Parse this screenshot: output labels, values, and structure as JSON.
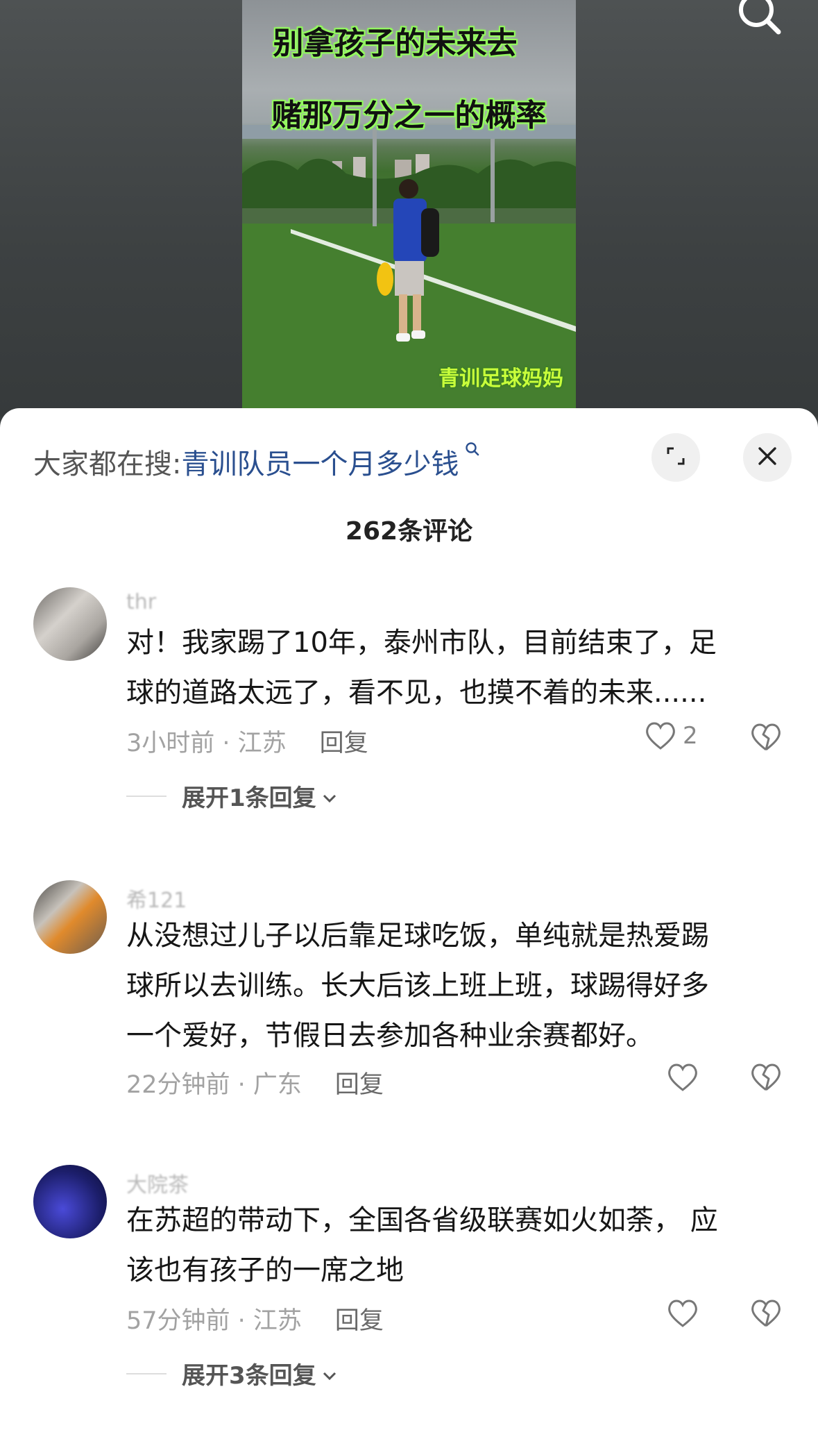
{
  "video": {
    "title_line1": "别拿孩子的未来去",
    "title_line2": "赌那万分之一的概率",
    "watermark": "青训足球妈妈"
  },
  "search_hint": {
    "prefix": "大家都在搜:",
    "query": "青训队员一个月多少钱"
  },
  "comments_count": "262条评论",
  "comments": [
    {
      "username": "thr",
      "text_lines": [
        "对！我家踢了10年，泰州市队，目前结束了，足",
        "球的道路太远了，看不见，也摸不着的未来......"
      ],
      "meta": "3小时前 · 江苏",
      "reply": "回复",
      "likes": "2",
      "expand": "展开1条回复"
    },
    {
      "username": "希121",
      "text_lines": [
        "从没想过儿子以后靠足球吃饭，单纯就是热爱踢",
        "球所以去训练。长大后该上班上班，球踢得好多",
        "一个爱好，节假日去参加各种业余赛都好。"
      ],
      "meta": "22分钟前 · 广东",
      "reply": "回复",
      "likes": "",
      "expand": ""
    },
    {
      "username": "大院茶",
      "text_lines": [
        "在苏超的带动下，全国各省级联赛如火如荼， 应",
        "该也有孩子的一席之地"
      ],
      "meta": "57分钟前 · 江苏",
      "reply": "回复",
      "likes": "",
      "expand": "展开3条回复"
    }
  ],
  "icons": {
    "top_search": "search-icon",
    "expand_sheet": "expand-icon",
    "close": "close-icon",
    "like": "heart-icon",
    "dislike": "broken-heart-icon",
    "chevron": "chevron-down-icon"
  }
}
